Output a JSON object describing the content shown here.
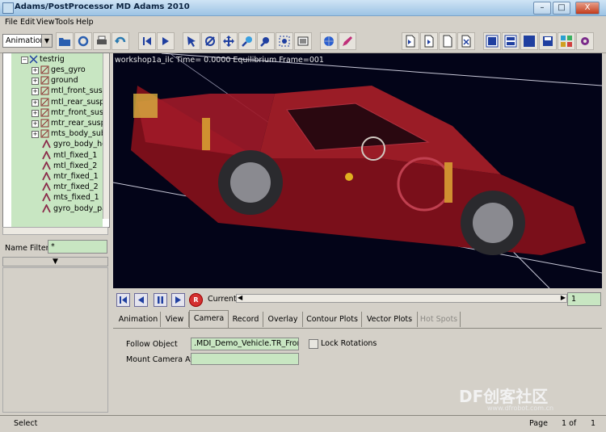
{
  "window": {
    "title": "Adams/PostProcessor MD Adams 2010",
    "btn_min": "–",
    "btn_max": "□",
    "btn_close": "X"
  },
  "menu": [
    "File",
    "Edit",
    "View",
    "Tools",
    "Help"
  ],
  "toolbar": {
    "mode": "Animation",
    "icons": [
      "open-icon",
      "refresh-icon",
      "print-icon",
      "undo-icon",
      "first-frame-icon",
      "play-icon",
      "select-icon",
      "rotate-icon",
      "translate-icon",
      "zoom-icon",
      "zoom-box-icon",
      "fit-icon",
      "render-icon",
      "globe-icon",
      "pen-icon",
      "page-nav-icon",
      "page-forward-icon",
      "page-new-icon",
      "page-delete-icon",
      "layout-1-icon",
      "layout-2-icon",
      "layout-3-icon",
      "save-icon",
      "settings-icon",
      "gear-icon"
    ]
  },
  "tree": {
    "root": "testrig",
    "items": [
      {
        "label": "ges_gyro",
        "expand": true
      },
      {
        "label": "ground",
        "expand": true
      },
      {
        "label": "mtl_front_susp",
        "expand": true
      },
      {
        "label": "mtl_rear_suspe",
        "expand": true
      },
      {
        "label": "mtr_front_susp",
        "expand": true
      },
      {
        "label": "mtr_rear_susp",
        "expand": true
      },
      {
        "label": "mts_body_sub",
        "expand": true
      },
      {
        "label": "gyro_body_ho",
        "expand": false
      },
      {
        "label": "mtl_fixed_1",
        "expand": false
      },
      {
        "label": "mtl_fixed_2",
        "expand": false
      },
      {
        "label": "mtr_fixed_1",
        "expand": false
      },
      {
        "label": "mtr_fixed_2",
        "expand": false
      },
      {
        "label": "mts_fixed_1",
        "expand": false
      },
      {
        "label": "gyro_body_paralle",
        "expand": false
      }
    ]
  },
  "filter": {
    "label": "Name Filter",
    "value": "*"
  },
  "viewport": {
    "label": "workshop1a_ilc   Time=  0.0000  Equilibrium  Frame=001"
  },
  "anim": {
    "current_label": "Current",
    "frame": "1"
  },
  "tabs": [
    "Animation",
    "View",
    "Camera",
    "Record",
    "Overlay",
    "Contour Plots",
    "Vector Plots",
    "Hot Spots"
  ],
  "selected_tab": "Camera",
  "camera": {
    "follow_label": "Follow Object",
    "follow_value": ".MDI_Demo_Vehicle.TR_Front_",
    "mount_label": "Mount Camera At",
    "mount_value": "",
    "lock_label": "Lock Rotations"
  },
  "status": {
    "mode": "Select",
    "page_label": "Page",
    "page_of": "1 of",
    "page_total": "1"
  },
  "watermark": {
    "text": "DF创客社区",
    "sub": "www.dfrobot.com.cn"
  }
}
